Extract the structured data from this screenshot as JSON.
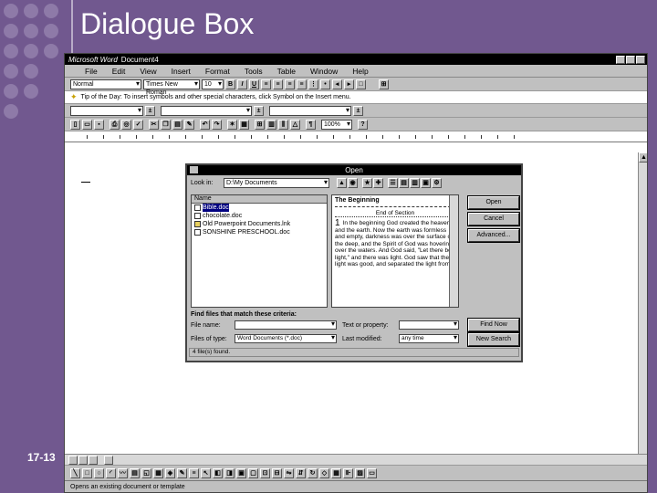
{
  "slide": {
    "title": "Dialogue Box",
    "number": "17-13"
  },
  "word": {
    "app_name": "Microsoft Word",
    "document": "Document4",
    "menu": [
      "File",
      "Edit",
      "View",
      "Insert",
      "Format",
      "Tools",
      "Table",
      "Window",
      "Help"
    ],
    "style_value": "Normal",
    "font_value": "Times New Roman",
    "size_value": "10",
    "tip": "Tip of the Day: To insert symbols and other special characters, click Symbol on the Insert menu.",
    "zoom_value": "100%",
    "status_text": "Opens an existing document or template"
  },
  "dialog": {
    "title": "Open",
    "look_in_label": "Look in:",
    "look_in_value": "D:\\My Documents",
    "name_header": "Name",
    "files": [
      {
        "name": "Bible.doc",
        "icon": "document-icon",
        "selected": true
      },
      {
        "name": "chocolate.doc",
        "icon": "document-icon",
        "selected": false
      },
      {
        "name": "Old Powerpoint Documents.lnk",
        "icon": "folder-icon",
        "selected": false
      },
      {
        "name": "SONSHINE PRESCHOOL.doc",
        "icon": "document-icon",
        "selected": false
      }
    ],
    "preview": {
      "title": "The Beginning",
      "section": "End of Section",
      "bignum": "1",
      "text": "In the beginning God created the heavens and the earth. Now the earth was formless and empty, darkness was over the surface of the deep, and the Spirit of God was hovering over the waters. And God said, \"Let there be light,\" and there was light. God saw that the light was good, and separated the light from"
    },
    "buttons": {
      "open": "Open",
      "cancel": "Cancel",
      "advanced": "Advanced...",
      "find_now": "Find Now",
      "new_search": "New Search"
    },
    "find_label": "Find files that match these criteria:",
    "file_name_label": "File name:",
    "file_name_value": "",
    "text_property_label": "Text or property:",
    "text_property_value": "",
    "files_of_type_label": "Files of type:",
    "files_of_type_value": "Word Documents (*.doc)",
    "last_modified_label": "Last modified:",
    "last_modified_value": "any time",
    "status": "4 file(s) found."
  }
}
